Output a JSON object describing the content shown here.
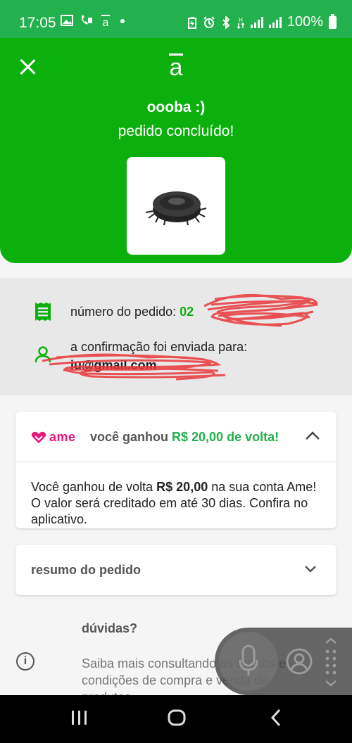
{
  "status_bar": {
    "time": "17:05",
    "battery": "100%",
    "left_icons": [
      "image-icon",
      "wifi-call-icon",
      "americanas-app-icon",
      "dot-icon"
    ],
    "right_icons": [
      "battery-saver-icon",
      "alarm-icon",
      "bluetooth-icon",
      "data-icon",
      "signal-icon",
      "signal-icon",
      "battery-icon"
    ]
  },
  "header": {
    "logo_letter": "a",
    "title": "oooba :)",
    "subtitle": "pedido concluído!",
    "close_icon": "close-icon",
    "product_image": "robot-vacuum-image"
  },
  "order_info": {
    "order_label": "número do pedido: ",
    "order_number": "02",
    "confirmation_label": "a confirmação foi enviada para:",
    "confirmation_email": "iu@gmail.com"
  },
  "cashback": {
    "logo_text": "ame",
    "heading_prefix": "você ganhou ",
    "heading_amount": "R$ 20,00 de volta!",
    "body_prefix": "Você ganhou de volta ",
    "body_amount": "R$ 20,00",
    "body_suffix": " na sua conta Ame! O valor será creditado em até 30 dias. Confira no aplicativo.",
    "expanded": true
  },
  "summary": {
    "label": "resumo do pedido",
    "expanded": false
  },
  "help": {
    "title": "dúvidas?",
    "body": "Saiba mais consultando os termos e condições de compra e venda de produtos"
  },
  "colors": {
    "brand_green": "#0cb00c",
    "status_green": "#22b14c",
    "ame_pink": "#e8157c",
    "redaction": "#e8373a"
  }
}
